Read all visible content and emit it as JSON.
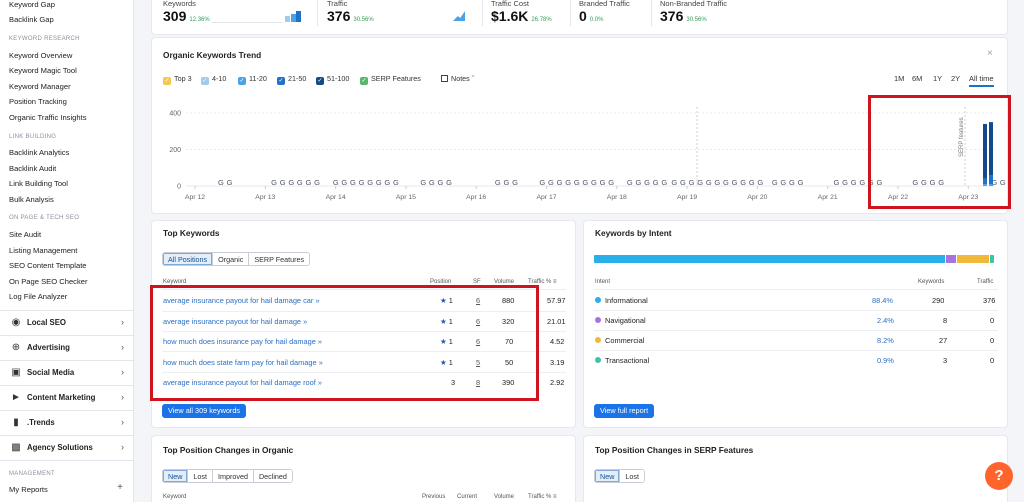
{
  "sidebar": {
    "top_items": [
      "Keyword Gap",
      "Backlink Gap"
    ],
    "sections": [
      {
        "title": "KEYWORD RESEARCH",
        "items": [
          "Keyword Overview",
          "Keyword Magic Tool",
          "Keyword Manager",
          "Position Tracking",
          "Organic Traffic Insights"
        ]
      },
      {
        "title": "LINK BUILDING",
        "items": [
          "Backlink Analytics",
          "Backlink Audit",
          "Link Building Tool",
          "Bulk Analysis"
        ]
      },
      {
        "title": "ON PAGE & TECH SEO",
        "items": [
          "Site Audit",
          "Listing Management",
          "SEO Content Template",
          "On Page SEO Checker",
          "Log File Analyzer"
        ]
      }
    ],
    "groups": [
      {
        "label": "Local SEO",
        "icon": "pin-icon"
      },
      {
        "label": "Advertising",
        "icon": "target-icon"
      },
      {
        "label": "Social Media",
        "icon": "social-icon"
      },
      {
        "label": "Content Marketing",
        "icon": "megaphone-icon"
      },
      {
        "label": ".Trends",
        "icon": "chart-bars-icon"
      },
      {
        "label": "Agency Solutions",
        "icon": "briefcase-icon"
      }
    ],
    "management_title": "MANAGEMENT",
    "management_items": [
      "My Reports"
    ]
  },
  "stats": [
    {
      "label": "Keywords",
      "value": "309",
      "delta": "12.36%"
    },
    {
      "label": "Traffic",
      "value": "376",
      "delta": "30.56%"
    },
    {
      "label": "Traffic Cost",
      "value": "$1.6K",
      "delta": "26.78%"
    },
    {
      "label": "Branded Traffic",
      "value": "0",
      "delta": "0.0%"
    },
    {
      "label": "Non-Branded Traffic",
      "value": "376",
      "delta": "30.56%"
    }
  ],
  "trend": {
    "title": "Organic Keywords Trend",
    "legend": [
      {
        "label": "Top 3",
        "color": "#f2c94c"
      },
      {
        "label": "4-10",
        "color": "#9ecbf0"
      },
      {
        "label": "11-20",
        "color": "#4aa3e6"
      },
      {
        "label": "21-50",
        "color": "#1f72c9"
      },
      {
        "label": "51-100",
        "color": "#144a8a"
      },
      {
        "label": "SERP Features",
        "color": "#59b66a"
      }
    ],
    "notes_label": "Notes",
    "ranges": [
      "1M",
      "6M",
      "1Y",
      "2Y",
      "All time"
    ],
    "active_range": "All time",
    "serp_label": "SERP features"
  },
  "chart_data": {
    "type": "bar",
    "y_ticks": [
      "400",
      "200",
      "0"
    ],
    "ylim": [
      0,
      400
    ],
    "x_tick_labels": [
      "Apr 12",
      "Apr 13",
      "Apr 14",
      "Apr 15",
      "Apr 16",
      "Apr 17",
      "Apr 18",
      "Apr 19",
      "Apr 20",
      "Apr 21",
      "Apr 22",
      "Apr 23"
    ],
    "series": [
      {
        "name": "51-100",
        "values": [
          300,
          290
        ]
      },
      {
        "name": "21-50",
        "values": [
          30,
          50
        ]
      },
      {
        "name": "11-20",
        "values": [
          10,
          10
        ]
      }
    ],
    "annotation_marker": "G",
    "marker_groups": [
      {
        "x": "Apr 12",
        "count": 2
      },
      {
        "x": "Apr 13",
        "count": 6
      },
      {
        "x": "Apr 14",
        "count": 8
      },
      {
        "x": "Apr 15",
        "count": 4
      },
      {
        "x": "Apr 16",
        "count": 3
      },
      {
        "x": "Apr 17",
        "count": 9
      },
      {
        "x": "Apr 18",
        "count": 5
      },
      {
        "x": "Apr 19",
        "count": 11
      },
      {
        "x": "Apr 20",
        "count": 4
      },
      {
        "x": "Apr 21",
        "count": 6
      },
      {
        "x": "Apr 22",
        "count": 4
      },
      {
        "x": "Apr 23",
        "count": 2
      }
    ]
  },
  "top_keywords": {
    "title": "Top Keywords",
    "tabs": [
      "All Positions",
      "Organic",
      "SERP Features"
    ],
    "active_tab": "All Positions",
    "headers": {
      "keyword": "Keyword",
      "position": "Position",
      "sf": "SF",
      "volume": "Volume",
      "traffic": "Traffic %"
    },
    "rows": [
      {
        "keyword": "average insurance payout for hail damage car",
        "position": "1",
        "sf": "6",
        "volume": "880",
        "traffic": "57.97"
      },
      {
        "keyword": "average insurance payout for hail damage",
        "position": "1",
        "sf": "6",
        "volume": "320",
        "traffic": "21.01"
      },
      {
        "keyword": "how much does insurance pay for hail damage",
        "position": "1",
        "sf": "6",
        "volume": "70",
        "traffic": "4.52"
      },
      {
        "keyword": "how much does state farm pay for hail damage",
        "position": "1",
        "sf": "5",
        "volume": "50",
        "traffic": "3.19"
      },
      {
        "keyword": "average insurance payout for hail damage roof",
        "position": "3",
        "sf": "8",
        "volume": "390",
        "traffic": "2.92"
      }
    ],
    "button": "View all 309 keywords"
  },
  "intent": {
    "title": "Keywords by Intent",
    "headers": {
      "intent": "Intent",
      "keywords": "Keywords",
      "traffic": "Traffic"
    },
    "rows": [
      {
        "label": "Informational",
        "pct": "88.4%",
        "keywords": "290",
        "traffic": "376",
        "color": "#2ab0e8",
        "share": 88.4
      },
      {
        "label": "Navigational",
        "pct": "2.4%",
        "keywords": "8",
        "traffic": "0",
        "color": "#a972e0",
        "share": 2.4
      },
      {
        "label": "Commercial",
        "pct": "8.2%",
        "keywords": "27",
        "traffic": "0",
        "color": "#f0b93a",
        "share": 8.2
      },
      {
        "label": "Transactional",
        "pct": "0.9%",
        "keywords": "3",
        "traffic": "0",
        "color": "#3ec2a8",
        "share": 0.9
      }
    ],
    "button": "View full report"
  },
  "pos_changes": {
    "title": "Top Position Changes in Organic",
    "tabs": [
      "New",
      "Lost",
      "Improved",
      "Declined"
    ],
    "active_tab": "New",
    "headers": {
      "keyword": "Keyword",
      "previous": "Previous",
      "current": "Current",
      "volume": "Volume",
      "traffic": "Traffic %"
    }
  },
  "serp_changes": {
    "title": "Top Position Changes in SERP Features",
    "tabs": [
      "New",
      "Lost"
    ],
    "active_tab": "New"
  },
  "help_label": "?"
}
